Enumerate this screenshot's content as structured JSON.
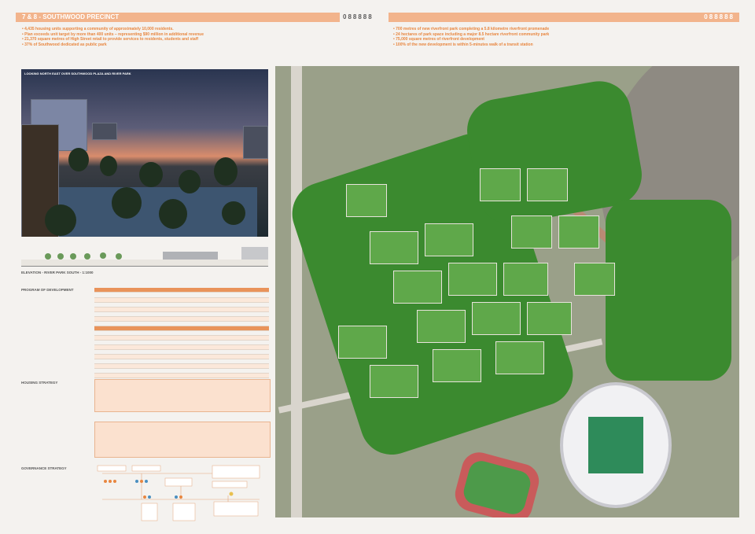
{
  "header": {
    "title": "7 & 8 - SOUTHWOOD PRECINCT",
    "code_left": "088888",
    "code_right": "088888"
  },
  "bullets_left": [
    "4,435 housing units supporting a community of approximately 10,000 residents.",
    "Plan exceeds unit target by more than 400 units – representing $90 million in additional revenue",
    "21,370 square metres of High Street retail to provide services to residents, students and staff",
    "37% of Southwood dedicated as public park"
  ],
  "bullets_right": [
    "700 metres of new riverfront park completing a 5.8 kilometre riverfront promenade",
    "24 hectares of park space including a major 8.5 hectare riverfront community park",
    "75,000 square metres of riverfront development",
    "100% of the new development is within 5-minutes walk of a transit station"
  ],
  "photo_caption": "LOOKING NORTH EAST OVER SOUTHWOOD PLAZA AND RIVER PARK",
  "elevation_label": "ELEVATION - RIVER PARK SOUTH - 1:1000",
  "sections": {
    "program": "PROGRAM OF DEVELOPMENT",
    "housing": "HOUSING STRATEGY",
    "governance": "GOVERNANCE STRATEGY"
  },
  "colors": {
    "accent": "#f2b48c",
    "accent_text": "#e8863f",
    "park": "#3b8a2f"
  }
}
